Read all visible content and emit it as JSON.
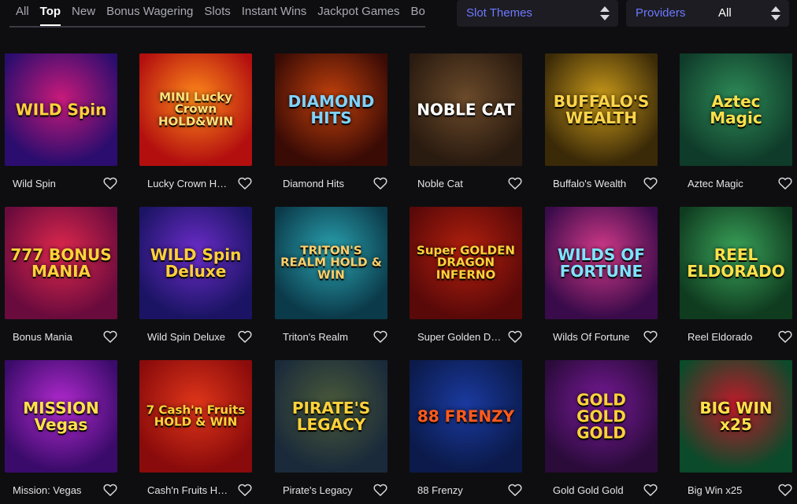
{
  "tabs": [
    {
      "label": "All"
    },
    {
      "label": "Top"
    },
    {
      "label": "New"
    },
    {
      "label": "Bonus Wagering"
    },
    {
      "label": "Slots"
    },
    {
      "label": "Instant Wins"
    },
    {
      "label": "Jackpot Games"
    },
    {
      "label": "Bo"
    }
  ],
  "active_tab": "Top",
  "filters": {
    "themes": {
      "label": "Slot Themes",
      "value": ""
    },
    "providers": {
      "label": "Providers",
      "value": "All"
    }
  },
  "games": [
    {
      "name": "Wild Spin",
      "logo": "WILD Spin",
      "colors": [
        "#2a0d6e",
        "#c81a7a"
      ],
      "logo_color": "#ffd23a"
    },
    {
      "name": "Lucky Crown Hold & Win",
      "logo": "MINI Lucky Crown HOLD&WIN",
      "colors": [
        "#b30f0f",
        "#ff8a1a"
      ],
      "logo_color": "#ffe27a"
    },
    {
      "name": "Diamond Hits",
      "logo": "DIAMOND HITS",
      "colors": [
        "#3a0b05",
        "#c2410c"
      ],
      "logo_color": "#7fd3ff"
    },
    {
      "name": "Noble Cat",
      "logo": "NOBLE CAT",
      "colors": [
        "#2a1b10",
        "#6b4a2a"
      ],
      "logo_color": "#ffffff"
    },
    {
      "name": "Buffalo's Wealth",
      "logo": "BUFFALO'S WEALTH",
      "colors": [
        "#3b2a08",
        "#c99a1a"
      ],
      "logo_color": "#ffd54a"
    },
    {
      "name": "Aztec Magic",
      "logo": "Aztec Magic",
      "colors": [
        "#0f3b2a",
        "#2e8b57"
      ],
      "logo_color": "#ffe14a"
    },
    {
      "name": "Bonus Mania",
      "logo": "777 BONUS MANIA",
      "colors": [
        "#6a0b3d",
        "#e0284d"
      ],
      "logo_color": "#ffd23a"
    },
    {
      "name": "Wild Spin Deluxe",
      "logo": "WILD Spin Deluxe",
      "colors": [
        "#1b1464",
        "#6b2cc9"
      ],
      "logo_color": "#ffcf3a"
    },
    {
      "name": "Triton's Realm",
      "logo": "TRITON'S REALM HOLD & WIN",
      "colors": [
        "#0b3a4a",
        "#2aa3b0"
      ],
      "logo_color": "#ffcf6a"
    },
    {
      "name": "Super Golden Dragon Inferno",
      "logo": "Super GOLDEN DRAGON INFERNO",
      "colors": [
        "#5a0909",
        "#b3200d"
      ],
      "logo_color": "#ffd23a"
    },
    {
      "name": "Wilds Of Fortune",
      "logo": "WILDS OF FORTUNE",
      "colors": [
        "#3a0b4a",
        "#d43a8a"
      ],
      "logo_color": "#7fe3ff"
    },
    {
      "name": "Reel Eldorado",
      "logo": "REEL ELDORADO",
      "colors": [
        "#0f3b1f",
        "#3aa35a"
      ],
      "logo_color": "#ffe14a"
    },
    {
      "name": "Mission: Vegas",
      "logo": "MISSION Vegas",
      "colors": [
        "#3a0b6a",
        "#b32ad0"
      ],
      "logo_color": "#ffe14a"
    },
    {
      "name": "Cash'n Fruits Hold & Win",
      "logo": "7 Cash'n Fruits HOLD & WIN",
      "colors": [
        "#8a0b0b",
        "#e0361a"
      ],
      "logo_color": "#ffd23a"
    },
    {
      "name": "Pirate's Legacy",
      "logo": "PIRATE'S LEGACY",
      "colors": [
        "#1a2a3a",
        "#4a5a3a"
      ],
      "logo_color": "#ffd23a"
    },
    {
      "name": "88 Frenzy",
      "logo": "88 FRENZY",
      "colors": [
        "#0b1a4a",
        "#1a3aa0"
      ],
      "logo_color": "#ff5a1a"
    },
    {
      "name": "Gold Gold Gold",
      "logo": "GOLD GOLD GOLD",
      "colors": [
        "#2a0b3a",
        "#7a1a9a"
      ],
      "logo_color": "#ffd23a"
    },
    {
      "name": "Big Win x25",
      "logo": "BIG WIN x25",
      "colors": [
        "#0b4a2a",
        "#c01a2a"
      ],
      "logo_color": "#ffe14a"
    }
  ],
  "colors": {
    "background": "#0e0e10",
    "select_bg": "#1c1c22",
    "accent_label": "#6d79ff",
    "tab_inactive": "#a9a9b3"
  },
  "icons": {
    "favorite": "heart-outline-icon",
    "select": "chevron-up-down-icon"
  }
}
